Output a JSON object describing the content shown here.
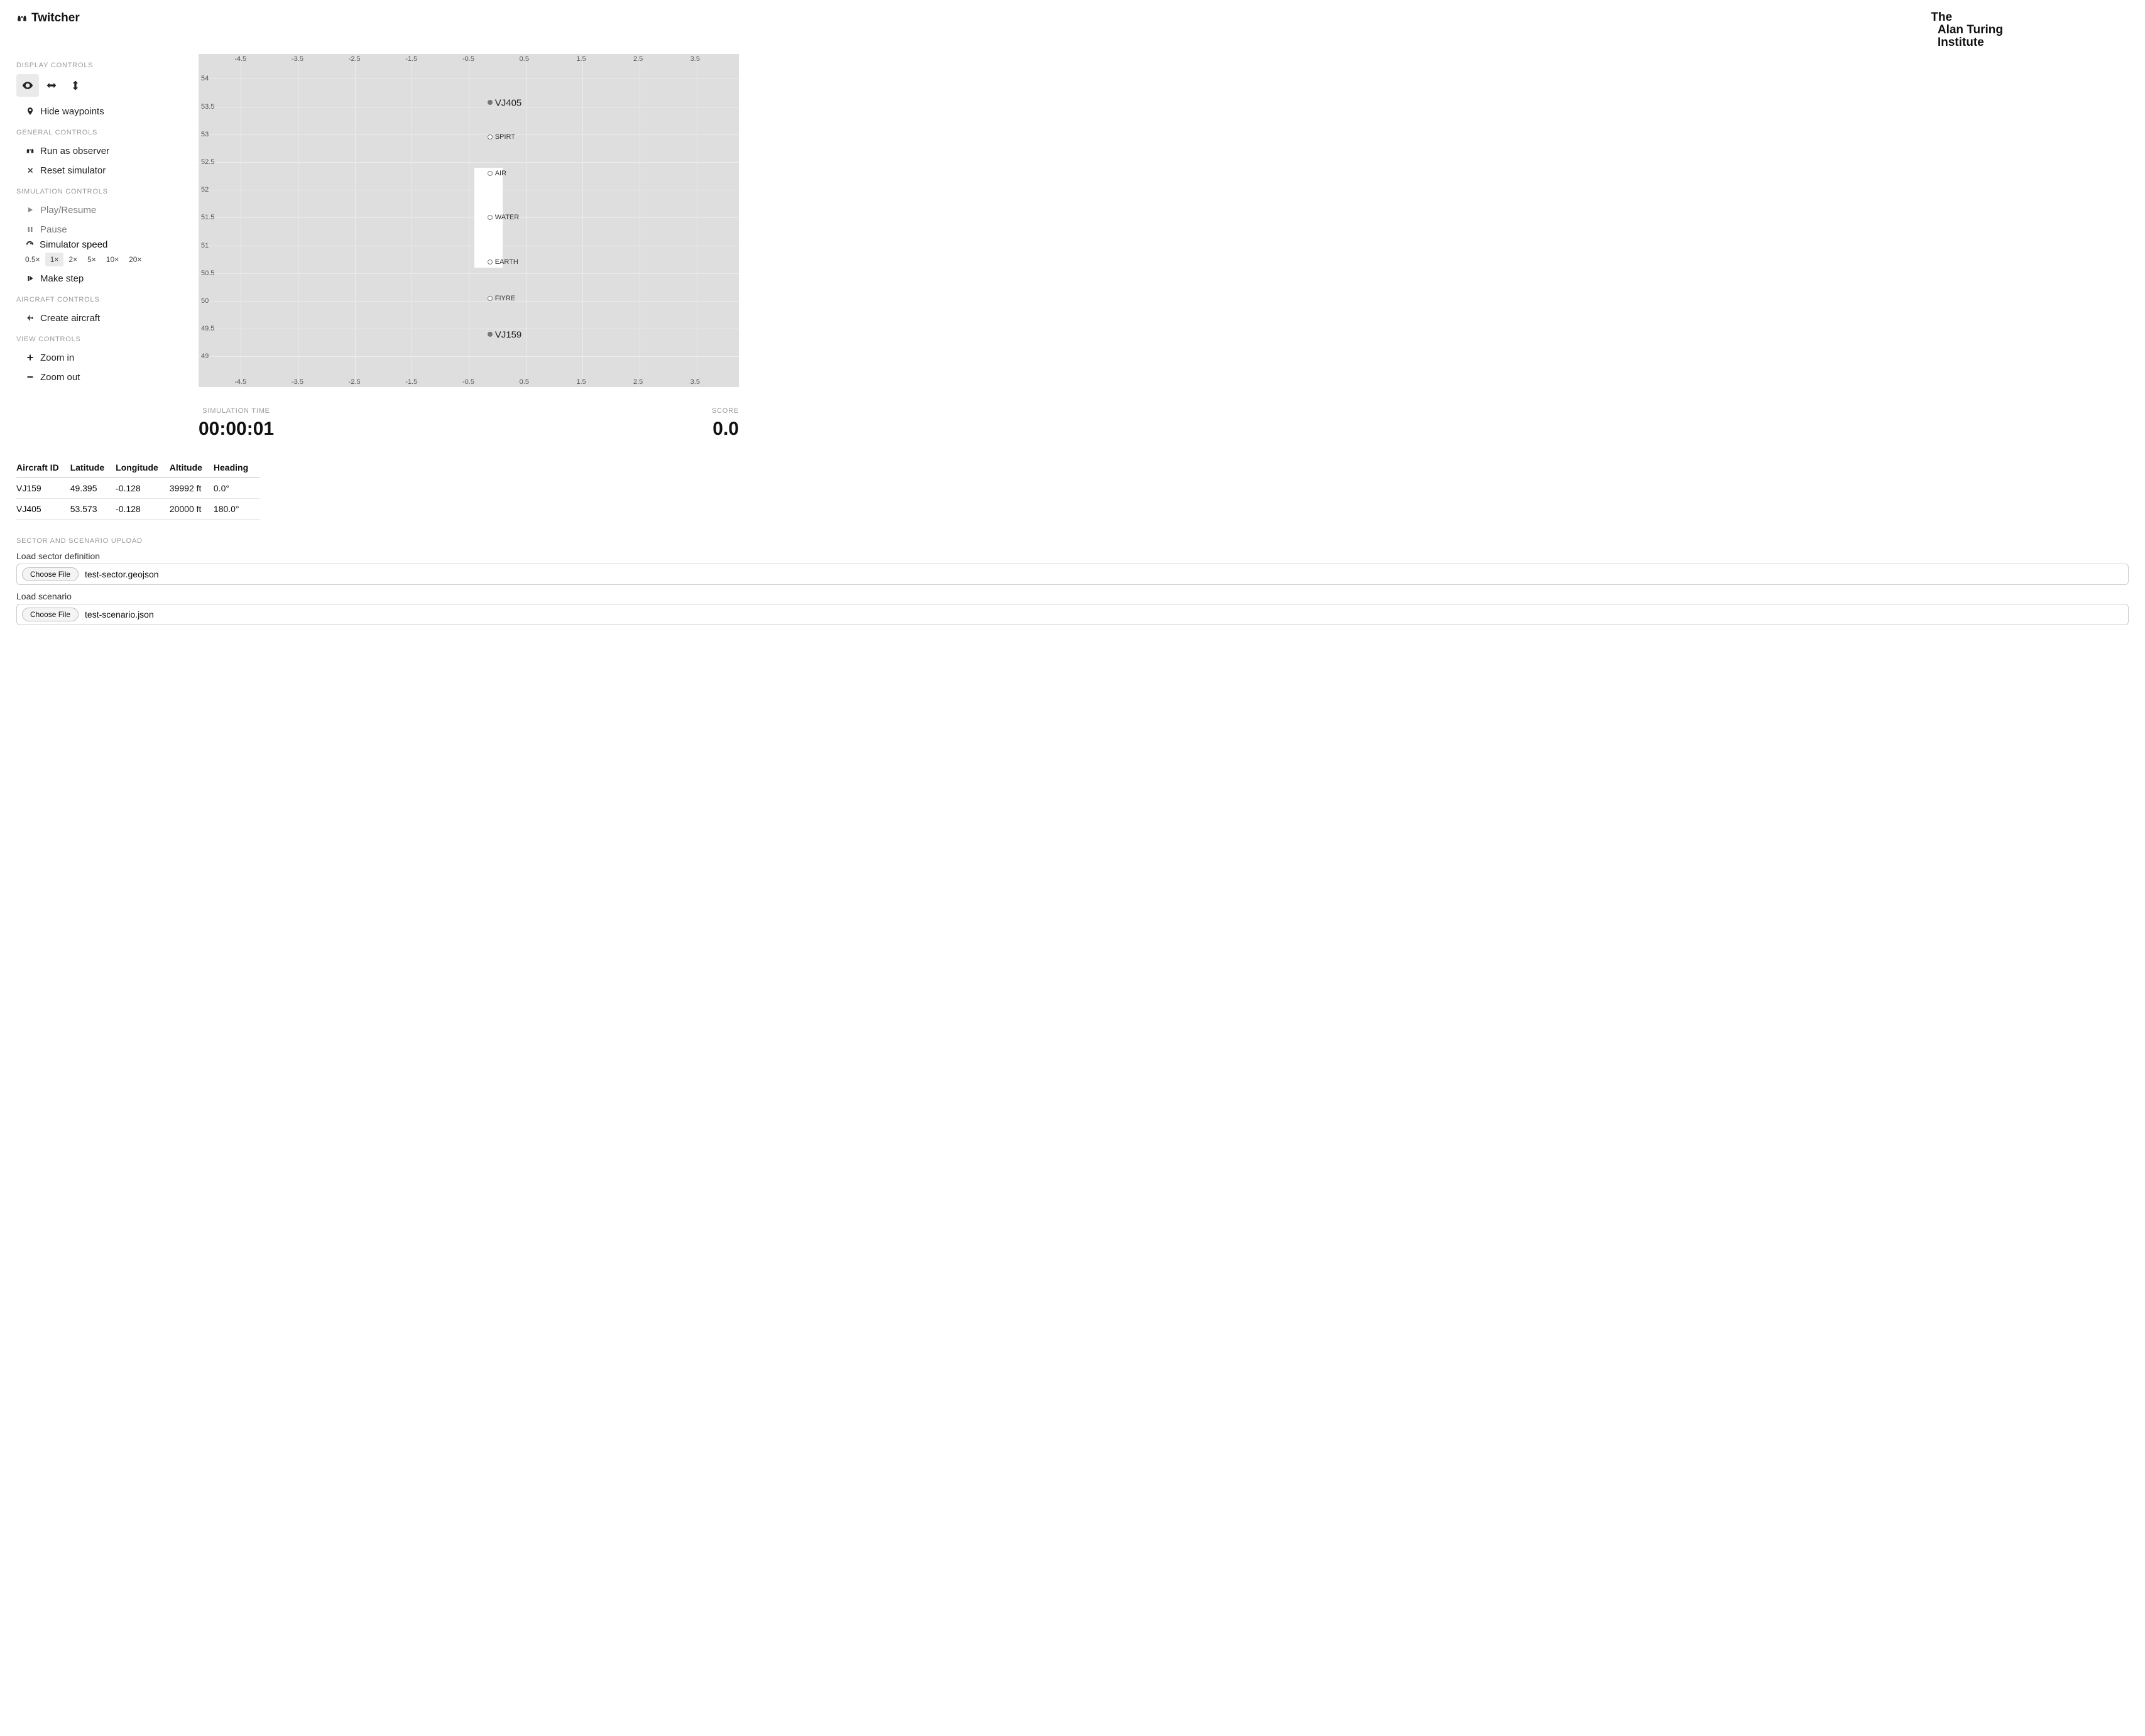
{
  "brand": "Twitcher",
  "org": {
    "l1": "The",
    "l2": "Alan Turing",
    "l3": "Institute"
  },
  "sections": {
    "display": "DISPLAY CONTROLS",
    "general": "GENERAL CONTROLS",
    "simulation": "SIMULATION CONTROLS",
    "aircraft": "AIRCRAFT CONTROLS",
    "view": "VIEW CONTROLS",
    "upload": "SECTOR AND SCENARIO UPLOAD"
  },
  "controls": {
    "hide_waypoints": "Hide waypoints",
    "run_observer": "Run as observer",
    "reset": "Reset simulator",
    "play": "Play/Resume",
    "pause": "Pause",
    "sim_speed": "Simulator speed",
    "make_step": "Make step",
    "create_aircraft": "Create aircraft",
    "zoom_in": "Zoom in",
    "zoom_out": "Zoom out"
  },
  "speeds": [
    "0.5×",
    "1×",
    "2×",
    "5×",
    "10×",
    "20×"
  ],
  "speed_selected": "1×",
  "sim_time": {
    "label": "SIMULATION TIME",
    "value": "00:00:01"
  },
  "score": {
    "label": "SCORE",
    "value": "0.0"
  },
  "table": {
    "headers": [
      "Aircraft ID",
      "Latitude",
      "Longitude",
      "Altitude",
      "Heading"
    ],
    "rows": [
      [
        "VJ159",
        "49.395",
        "-0.128",
        "39992 ft",
        "0.0°"
      ],
      [
        "VJ405",
        "53.573",
        "-0.128",
        "20000 ft",
        "180.0°"
      ]
    ]
  },
  "upload": {
    "sector_label": "Load sector definition",
    "scenario_label": "Load scenario",
    "choose": "Choose File",
    "sector_file": "test-sector.geojson",
    "scenario_file": "test-scenario.json"
  },
  "chart_data": {
    "type": "scatter",
    "xlim": [
      -5,
      4
    ],
    "ylim": [
      48.7,
      54.2
    ],
    "xticks": [
      -4.5,
      -3.5,
      -2.5,
      -1.5,
      -0.5,
      0.5,
      1.5,
      2.5,
      3.5
    ],
    "yticks": [
      49,
      49.5,
      50,
      50.5,
      51,
      51.5,
      52,
      52.5,
      53,
      53.5,
      54
    ],
    "sector_rect": {
      "x0": -0.4,
      "x1": 0.1,
      "y0": 50.6,
      "y1": 52.4
    },
    "waypoints": [
      {
        "name": "SPIRT",
        "x": -0.128,
        "y": 52.95
      },
      {
        "name": "AIR",
        "x": -0.128,
        "y": 52.3
      },
      {
        "name": "WATER",
        "x": -0.128,
        "y": 51.5
      },
      {
        "name": "EARTH",
        "x": -0.128,
        "y": 50.7
      },
      {
        "name": "FIYRE",
        "x": -0.128,
        "y": 50.05
      }
    ],
    "aircraft": [
      {
        "name": "VJ405",
        "x": -0.128,
        "y": 53.573
      },
      {
        "name": "VJ159",
        "x": -0.128,
        "y": 49.395
      }
    ]
  }
}
